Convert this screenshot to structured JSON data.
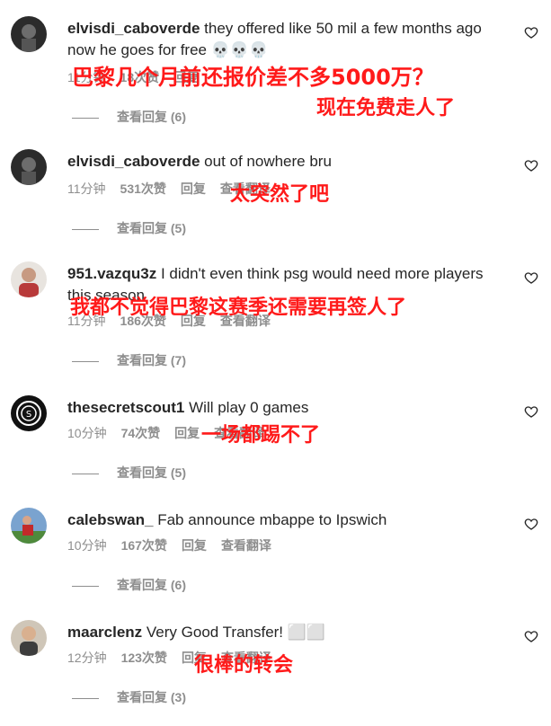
{
  "comments": [
    {
      "username": "elvisdi_caboverde",
      "text": "they offered like 50 mil a few months ago now he goes for free 💀💀💀",
      "time": "11分钟",
      "likes": "18次赞",
      "reply": "回复",
      "translate": "",
      "view_replies": "查看回复 (6)",
      "overlay": [
        "巴黎几个月前还报价差不多5000万？",
        "现在免费走人了"
      ]
    },
    {
      "username": "elvisdi_caboverde",
      "text": "out of nowhere bru",
      "time": "11分钟",
      "likes": "531次赞",
      "reply": "回复",
      "translate": "查看翻译",
      "view_replies": "查看回复 (5)",
      "overlay": [
        "太突然了吧"
      ]
    },
    {
      "username": "951.vazqu3z",
      "text": "I didn't even think psg would need more players this season",
      "time": "11分钟",
      "likes": "186次赞",
      "reply": "回复",
      "translate": "查看翻译",
      "view_replies": "查看回复 (7)",
      "overlay": [
        "我都不觉得巴黎这赛季还需要再签人了"
      ]
    },
    {
      "username": "thesecretscout1",
      "text": "Will play 0 games",
      "time": "10分钟",
      "likes": "74次赞",
      "reply": "回复",
      "translate": "查看翻译",
      "view_replies": "查看回复 (5)",
      "overlay": [
        "一场都踢不了"
      ]
    },
    {
      "username": "calebswan_",
      "text": "Fab announce mbappe to Ipswich",
      "time": "10分钟",
      "likes": "167次赞",
      "reply": "回复",
      "translate": "查看翻译",
      "view_replies": "查看回复 (6)",
      "overlay": []
    },
    {
      "username": "maarclenz",
      "text": "Very Good Transfer! ⬜⬜",
      "time": "12分钟",
      "likes": "123次赞",
      "reply": "回复",
      "translate": "查看翻译",
      "view_replies": "查看回复 (3)",
      "overlay": [
        "很棒的转会"
      ]
    }
  ],
  "colors": {
    "text": "#262626",
    "muted": "#8e8e8e",
    "overlay_red": "#ff1a1a"
  },
  "icons": [
    "heart-icon"
  ]
}
